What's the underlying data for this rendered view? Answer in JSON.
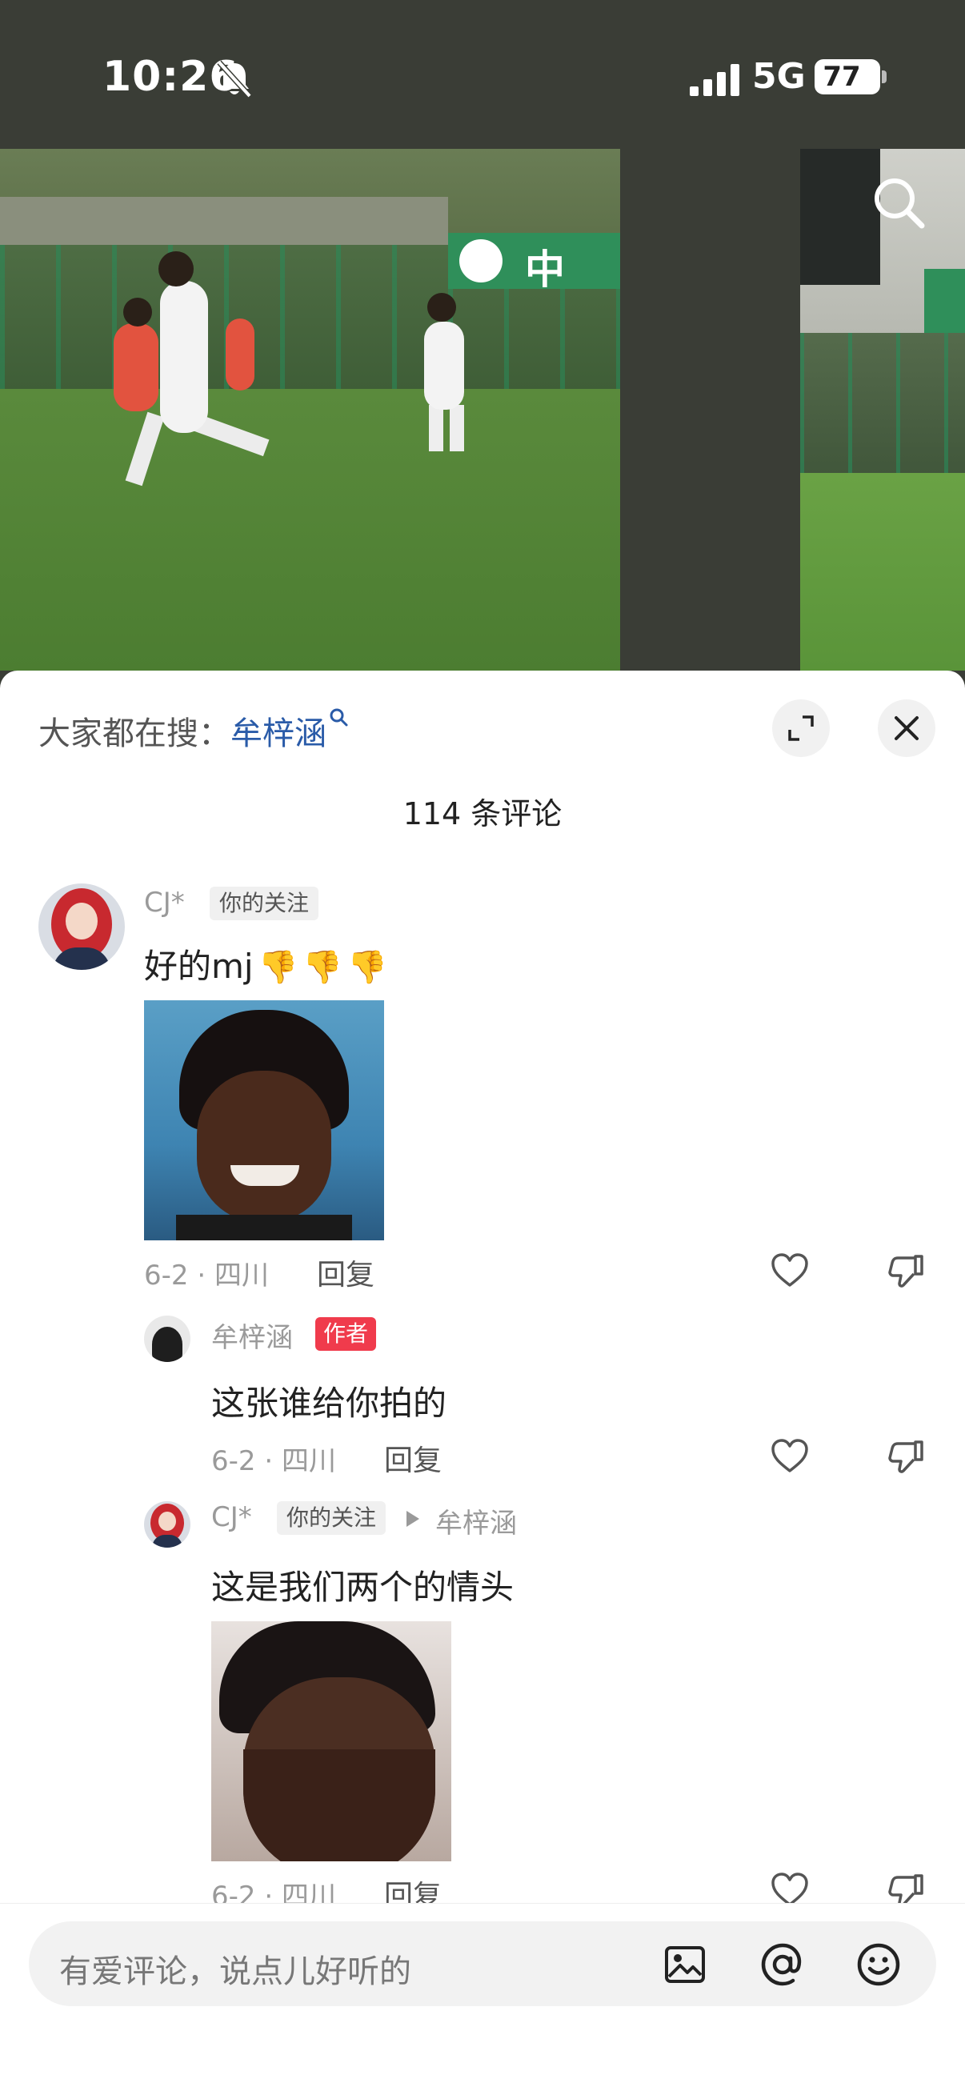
{
  "status_bar": {
    "time": "10:26",
    "network": "5G",
    "battery": "77"
  },
  "photo_banner_char": "中",
  "sheet": {
    "hot_search_label": "大家都在搜：",
    "hot_search_term": "牟梓涵",
    "comment_count": "114 条评论"
  },
  "comments": [
    {
      "user": "CJ*",
      "tag": "你的关注",
      "text": "好的mj",
      "emojis": [
        "👎",
        "👎",
        "👎"
      ],
      "date_location": "6-2 · 四川",
      "reply_label": "回复"
    }
  ],
  "replies": [
    {
      "user": "牟梓涵",
      "tag": "作者",
      "text": "这张谁给你拍的",
      "date_location": "6-2 · 四川",
      "reply_label": "回复"
    },
    {
      "user": "CJ*",
      "tag": "你的关注",
      "reply_to": "牟梓涵",
      "text": "这是我们两个的情头",
      "date_location": "6-2 · 四川",
      "reply_label": "回复"
    }
  ],
  "input": {
    "placeholder": "有爱评论，说点儿好听的"
  },
  "icons": {
    "top_right": "search-icon",
    "sheet": [
      "expand-icon",
      "close-icon"
    ],
    "actions": [
      "heart-icon",
      "dislike-icon"
    ],
    "input": [
      "image-icon",
      "at-icon",
      "emoji-icon"
    ]
  },
  "colors": {
    "link_blue": "#2a5ba8",
    "author_badge": "#f03b4c",
    "muted": "#9a9a9a"
  }
}
